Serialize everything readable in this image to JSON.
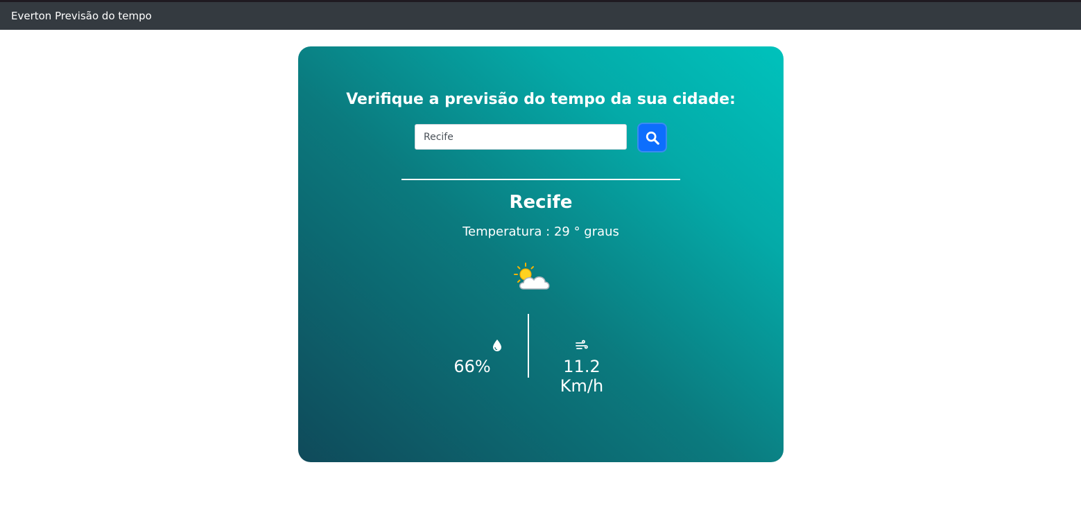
{
  "navbar": {
    "brand": "Everton Previsão do tempo"
  },
  "search": {
    "heading": "Verifique a previsão do tempo da sua cidade:",
    "value": "Recife",
    "button_icon": "search-icon"
  },
  "weather": {
    "city": "Recife",
    "temperature_text": "Temperatura : 29 ° graus",
    "condition_icon": "partly-cloudy-icon",
    "humidity": "66%",
    "humidity_icon": "water-drop-icon",
    "wind": "11.2 Km/h",
    "wind_icon": "wind-icon"
  },
  "colors": {
    "navbar": "#343a40",
    "card_gradient_start": "#0f4a5a",
    "card_gradient_end": "#00c2bc",
    "search_button": "#0d6efd"
  }
}
